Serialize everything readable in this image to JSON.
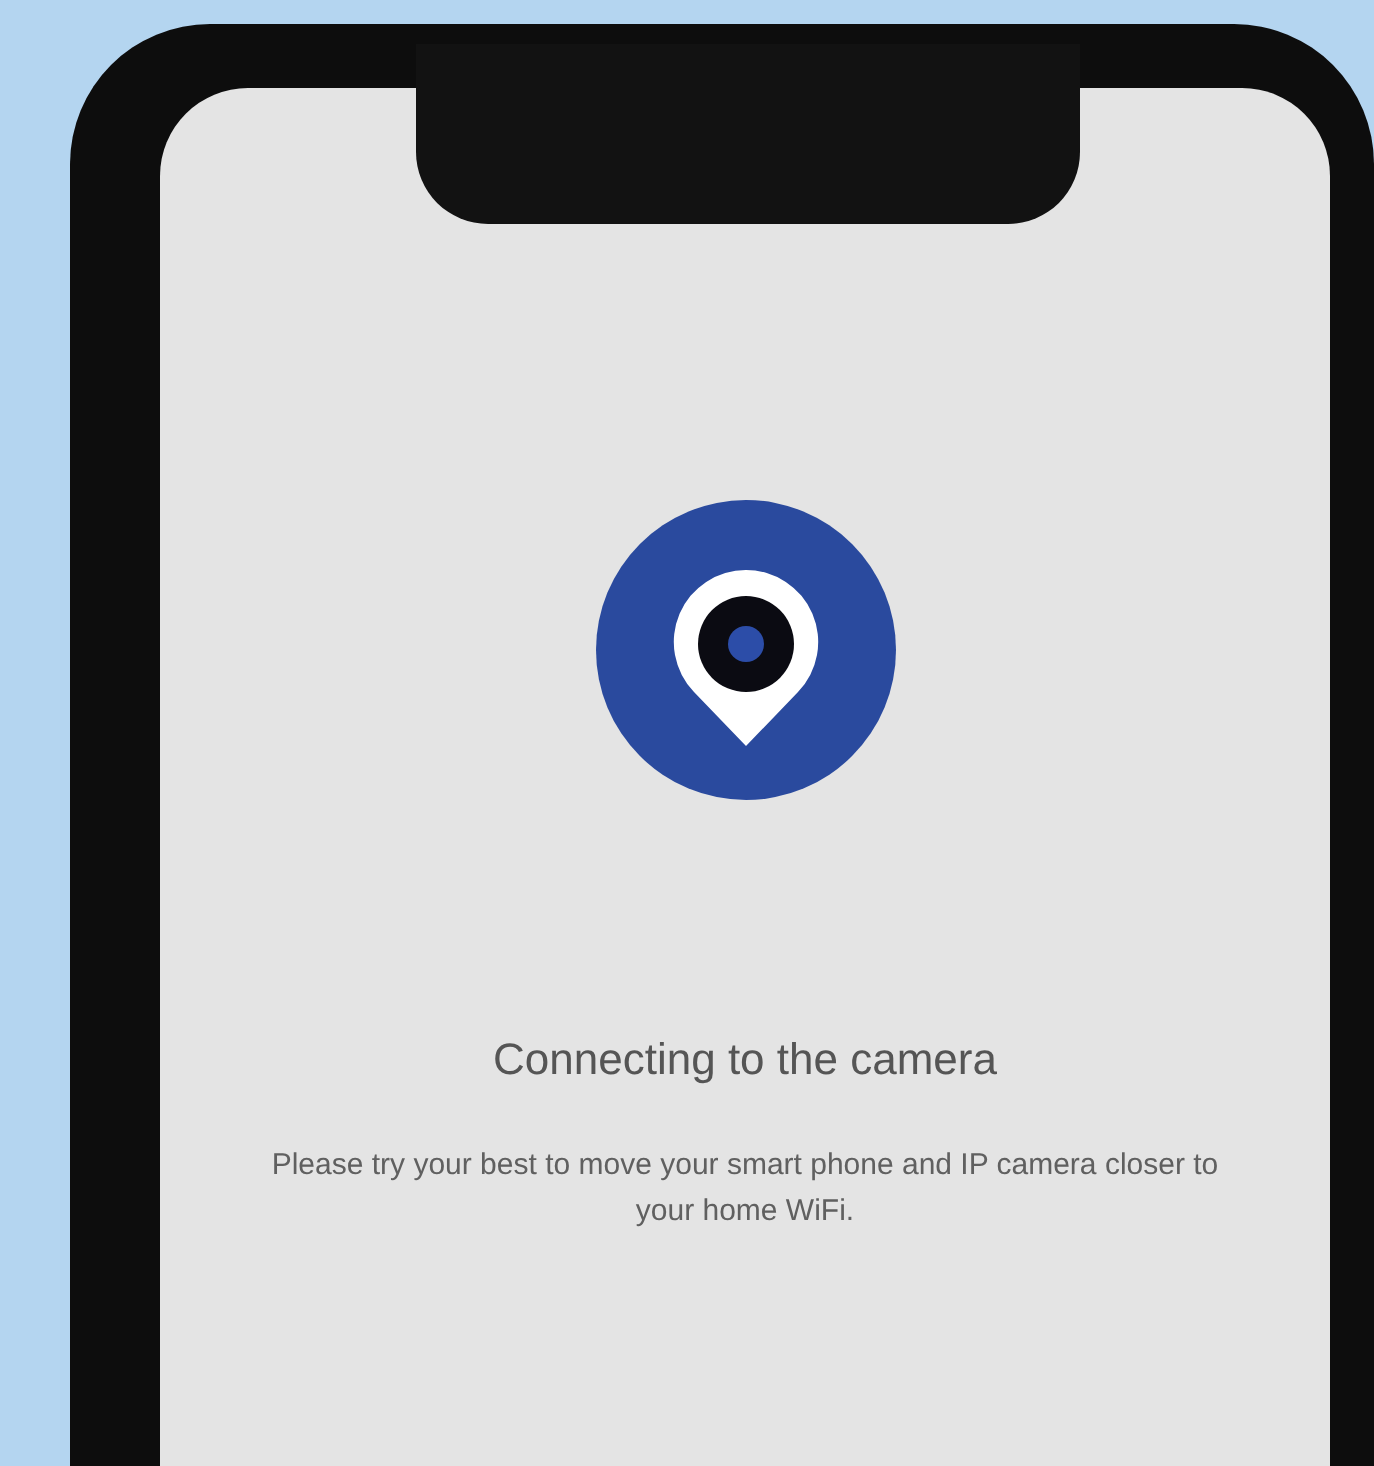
{
  "screen": {
    "title": "Connecting to the camera",
    "message": "Please try your best to move your smart phone and IP camera closer to your home WiFi."
  }
}
